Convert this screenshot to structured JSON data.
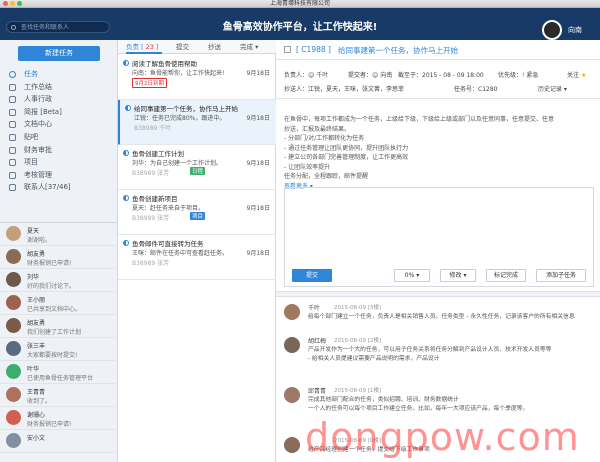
{
  "window": {
    "title": "上海青壕科技有限公司"
  },
  "topbar": {
    "search_placeholder": "查找任务和联系人",
    "slogan": "鱼骨高效协作平台，让工作快起来!",
    "user": "向南"
  },
  "sidebar": {
    "new_task": "新建任务",
    "items": [
      {
        "label": "任务"
      },
      {
        "label": "工作总结"
      },
      {
        "label": "人事行政"
      },
      {
        "label": "简报 [Beta]"
      },
      {
        "label": "文档中心"
      },
      {
        "label": "贴吧"
      },
      {
        "label": "财务审批"
      },
      {
        "label": "项目"
      },
      {
        "label": "考核管理"
      },
      {
        "label": "联系人[37/46]"
      }
    ]
  },
  "contacts": [
    {
      "name": "夏天",
      "msg": "谢谢啦。",
      "color": "#c4a07a"
    },
    {
      "name": "胡友勇",
      "msg": "财务报销已申请!",
      "color": "#8a6b55"
    },
    {
      "name": "刘华",
      "msg": "好的我们讨论下。",
      "color": "#6a5a4a"
    },
    {
      "name": "王小丽",
      "msg": "已共享到文档中心。",
      "color": "#a06050"
    },
    {
      "name": "胡友勇",
      "msg": "我们创建了工作计划",
      "color": "#7a5a48"
    },
    {
      "name": "张三丰",
      "msg": "大家都要按时提交!",
      "color": "#5a6a80"
    },
    {
      "name": "叶华",
      "msg": "已使用鱼骨任务管理平台",
      "color": "#3cae6a"
    },
    {
      "name": "王青青",
      "msg": "收到了。",
      "color": "#b07060"
    },
    {
      "name": "谢珊心",
      "msg": "财务报销已申请!",
      "color": "#d06050"
    },
    {
      "name": "安小文",
      "msg": "",
      "color": "#8090a0"
    }
  ],
  "tabs": {
    "owner": "负责",
    "owner_count": "23",
    "submit": "提交",
    "cc": "抄送",
    "done": "完成"
  },
  "tasks": [
    {
      "title": "阅读了解鱼骨使用帮助",
      "sub": "向南：鱼骨能帮你，让工作快起来!",
      "date": "9月18日",
      "code": "",
      "badge": "9月2日到期"
    },
    {
      "title": "给同事建第一个任务，协作马上开始",
      "sub": "江锐：任务已完成80%，跟进中。",
      "date": "9月18日",
      "code": "B38989 千叶",
      "badge": ""
    },
    {
      "title": "鱼骨创建工作计划",
      "sub": "刘华：为自己创建一个工作计划。",
      "date": "9月18日",
      "code": "B38989 张芳",
      "badge": "日程"
    },
    {
      "title": "鱼骨创建新项目",
      "sub": "夏天：赶任务来自于项目。",
      "date": "9月18日",
      "code": "B38989 张芳",
      "badge": "项目"
    },
    {
      "title": "鱼骨邮件可直接转为任务",
      "sub": "王咪：邮件在任务中可查看赶任务。",
      "date": "9月18日",
      "code": "B38989 张芳",
      "badge": ""
    }
  ],
  "detail": {
    "id": "[ C1988 ]",
    "title": "给同事建第一个任务，协作马上开始",
    "owner_label": "负责人：",
    "owner": "千叶",
    "submitter_label": "提交者：",
    "submitter": "向南",
    "deadline_label": "截至于：",
    "deadline": "2015 - 08 - 09 18:00",
    "priority_label": "优先级：",
    "priority": "紧急",
    "follow": "关注",
    "cc_label": "抄送人：",
    "cc": "江锐，夏天，王咪，张文菁，李思菲",
    "task_no_label": "任务号：",
    "task_no": "C1280",
    "history": "历史记录",
    "desc": [
      "在鱼骨中，每项工作都成为一个任务，上级给下级，下级给上级或部门以及任意同事，任意提交、任意",
      "抄送，汇报及最终结果。",
      "- 分部门/对/工作都转化为任务",
      "- 通过任务管理让团队更协同，提升团队执行力",
      "- 建立公司各部门完善管理制度，让工作更高效",
      "- 让团队效率提升",
      "任务分配，全程跟踪，邮件提醒"
    ],
    "more": "查看更多",
    "submit": "提交",
    "percent": "0%",
    "edit": "修改",
    "mark_done": "标记完成",
    "add_sub": "添加子任务"
  },
  "comments": [
    {
      "name": "千叶",
      "time": "2015-08-09 [3楼]",
      "text": "给每个部门建立一个任务，负责人是相关销售人员。任务类型 - 永久性任务，记录该客户的所有相关信息",
      "color": "#a07860"
    },
    {
      "name": "胡红梅",
      "time": "2015-08-09 [2楼]",
      "text": "产品开发作为一个大的任务，可以用子任务关系将任务分解到产品设计人员、技术开发人员等等\n- 给相关人员提建议需要产品说明的需求，产品设计",
      "color": "#7a6658"
    },
    {
      "name": "邱青青",
      "time": "2015-08-09 [1楼]",
      "text": "完成其他部门配合的任务，类似招聘、培训、财务数据统计\n一个人的任务可以每个项目工作建立任务，比如，每年一大项应该产品，每个季度等。",
      "color": "#9a7a68"
    },
    {
      "name": "",
      "time": "2015-08-09 [0楼]",
      "text": "给产品经理创建一个任务，提交给下级工作事项",
      "color": "#8a6a5a"
    }
  ],
  "watermark": "dongpow.com"
}
